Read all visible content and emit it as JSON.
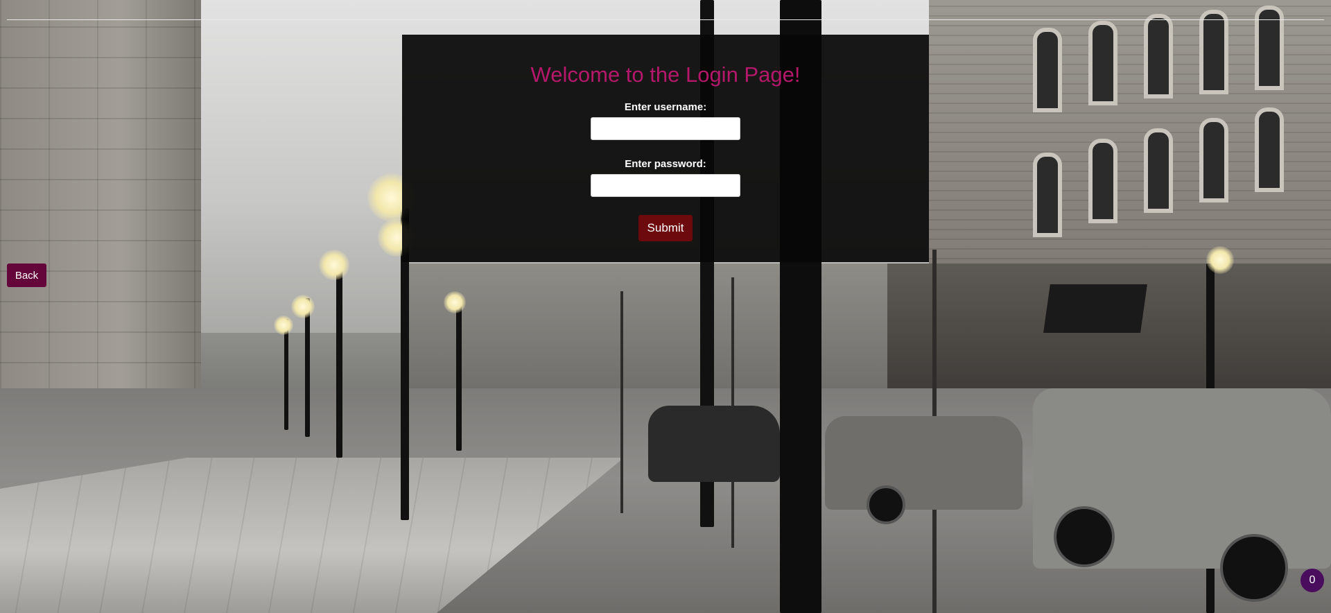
{
  "login": {
    "title": "Welcome to the Login Page!",
    "username_label": "Enter username:",
    "username_value": "",
    "password_label": "Enter password:",
    "password_value": "",
    "submit_label": "Submit"
  },
  "nav": {
    "back_label": "Back"
  },
  "badge": {
    "count": "0"
  },
  "colors": {
    "title": "#b5186a",
    "submit_bg": "#6c0a0e",
    "back_bg": "#64063a",
    "badge_bg": "#4a0c5c",
    "panel_bg": "#080808"
  }
}
